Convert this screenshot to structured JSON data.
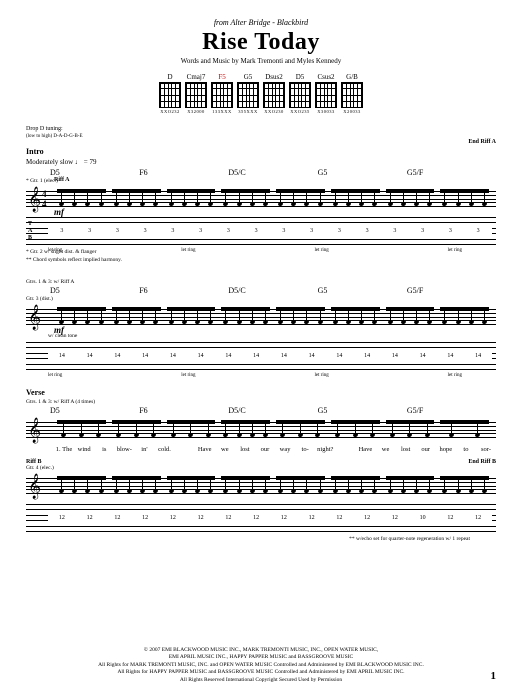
{
  "header": {
    "source_prefix": "from Alter Bridge -",
    "album": "Blackbird",
    "title": "Rise Today",
    "credits": "Words and Music by Mark Tremonti and Myles Kennedy"
  },
  "chords": [
    {
      "name": "D",
      "fingering": "XXO232"
    },
    {
      "name": "Cmaj7",
      "fingering": "X32000"
    },
    {
      "name": "F5",
      "fingering": "133XXX",
      "highlight": true
    },
    {
      "name": "G5",
      "fingering": "355XXX"
    },
    {
      "name": "Dsus2",
      "fingering": "XXO230"
    },
    {
      "name": "D5",
      "fingering": "XXO235"
    },
    {
      "name": "Csus2",
      "fingering": "X30033"
    },
    {
      "name": "G/B",
      "fingering": "X20033"
    }
  ],
  "tuning": {
    "label": "Drop D tuning:",
    "detail": "(low to high) D-A-D-G-B-E"
  },
  "sections": {
    "intro": {
      "label": "Intro",
      "tempo": "Moderately slow ♩ = 79",
      "chord_line": [
        "D5",
        "F6",
        "D5/C",
        "G5",
        "G5/F"
      ],
      "gtr1_label": "* Gtr. 1 (elec.)",
      "riff_a": "Riff A",
      "end_riff_a": "End Riff A",
      "dynamic": "mf",
      "tab_numbers": [
        "3",
        "3",
        "3",
        "3",
        "3",
        "3",
        "3",
        "3",
        "3",
        "3",
        "3",
        "3",
        "3",
        "3",
        "3",
        "3"
      ],
      "technique": [
        "let ring",
        "",
        "",
        "let ring",
        "",
        "",
        "let ring",
        "",
        "",
        "let ring"
      ],
      "gtr2_note": "* Gtr. 2 w/ slight dist. & flanger",
      "chord_sym_note": "** Chord symbols reflect implied harmony."
    },
    "intro2": {
      "gtr_label": "Gtrs. 1 & 3: w/ Riff A",
      "chord_line": [
        "D5",
        "F6",
        "D5/C",
        "G5",
        "G5/F"
      ],
      "gtr3_label": "Gtr. 3 (dist.)",
      "dynamic": "mf",
      "tech_label": "w/ clean tone",
      "tab_numbers_top": [
        "14",
        "14",
        "14",
        "14",
        "14",
        "14",
        "14",
        "14",
        "14",
        "14",
        "14",
        "14",
        "14",
        "14",
        "14",
        "14"
      ],
      "technique": [
        "let ring",
        "",
        "",
        "let ring",
        "",
        "",
        "let ring",
        "",
        "",
        "let ring"
      ]
    },
    "verse": {
      "label": "Verse",
      "gtr_label": "Gtrs. 1 & 3: w/ Riff A (4 times)",
      "chord_line": [
        "D5",
        "F6",
        "D5/C",
        "G5",
        "G5/F"
      ],
      "lyric_words": [
        "1. The",
        "wind",
        "is",
        "blow-",
        "in'",
        "cold.",
        "",
        "Have",
        "we",
        "lost",
        "our",
        "way",
        "to-",
        "night?",
        "",
        "Have",
        "we",
        "lost",
        "our",
        "hope",
        "to",
        "sor-"
      ],
      "riff_b": "Riff B",
      "end_riff_b": "End Riff B",
      "gtr4_label": "Gtr. 4 (elec.)",
      "tab_numbers": [
        "12",
        "12",
        "12",
        "12",
        "12",
        "12",
        "12",
        "12",
        "12",
        "12",
        "12",
        "12",
        "12",
        "10",
        "12",
        "12"
      ],
      "footnote": "** w/echo set for quarter-note regeneration w/ 1 repeat"
    }
  },
  "footer": {
    "line1": "© 2007 EMI BLACKWOOD MUSIC INC., MARK TREMONTI MUSIC, INC., OPEN WATER MUSIC,",
    "line2": "EMI APRIL MUSIC INC., HAPPY PAPPER MUSIC and BASSGROOVE MUSIC",
    "line3": "All Rights for MARK TREMONTI MUSIC, INC. and OPEN WATER MUSIC Controlled and Administered by EMI BLACKWOOD MUSIC INC.",
    "line4": "All Rights for HAPPY PAPPER MUSIC and BASSGROOVE MUSIC Controlled and Administered by EMI APRIL MUSIC INC.",
    "line5": "All Rights Reserved   International Copyright Secured   Used by Permission",
    "page": "1"
  }
}
